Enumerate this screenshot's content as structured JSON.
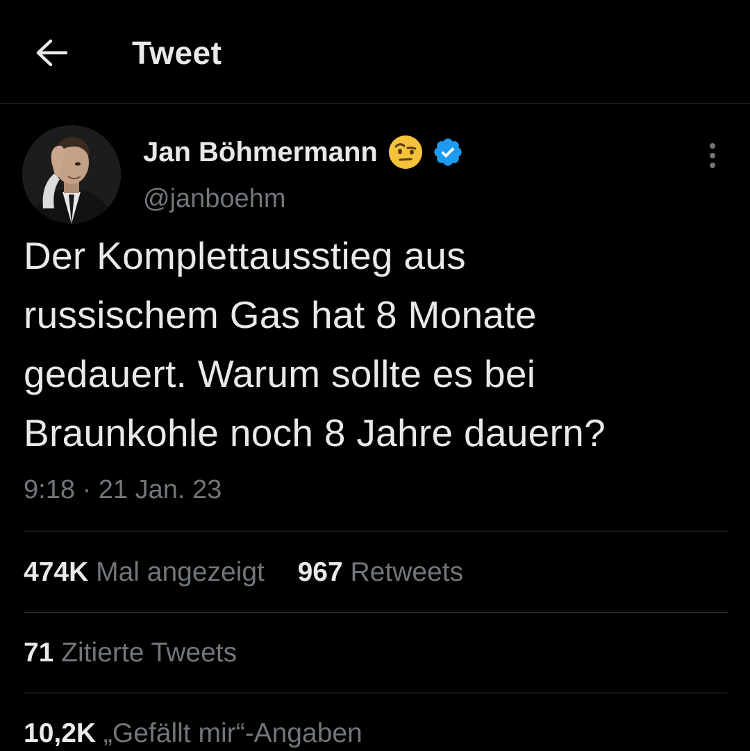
{
  "header": {
    "title": "Tweet",
    "back_icon": "arrow-left-icon"
  },
  "author": {
    "display_name": "Jan Böhmermann",
    "handle": "@janboehm",
    "emoji_icon": "face-with-raised-eyebrow-icon",
    "verified_icon": "verified-badge-icon",
    "verified_color": "#1d9bf0"
  },
  "tweet": {
    "text": "Der Komplettausstieg aus\nrussischem Gas hat 8 Monate\ngedauert. Warum sollte es bei\nBraunkohle noch 8 Jahre dauern?",
    "time": "9:18",
    "separator": "·",
    "date": "21 Jan. 23"
  },
  "stats": {
    "views_count": "474K",
    "views_label": "Mal angezeigt",
    "retweets_count": "967",
    "retweets_label": "Retweets",
    "quotes_count": "71",
    "quotes_label": "Zitierte Tweets",
    "likes_count": "10,2K",
    "likes_label": "„Gefällt mir“-Angaben"
  },
  "colors": {
    "background": "#000000",
    "text_primary": "#e7e9ea",
    "text_secondary": "#71767b",
    "divider": "#2f3336",
    "accent": "#1d9bf0"
  }
}
